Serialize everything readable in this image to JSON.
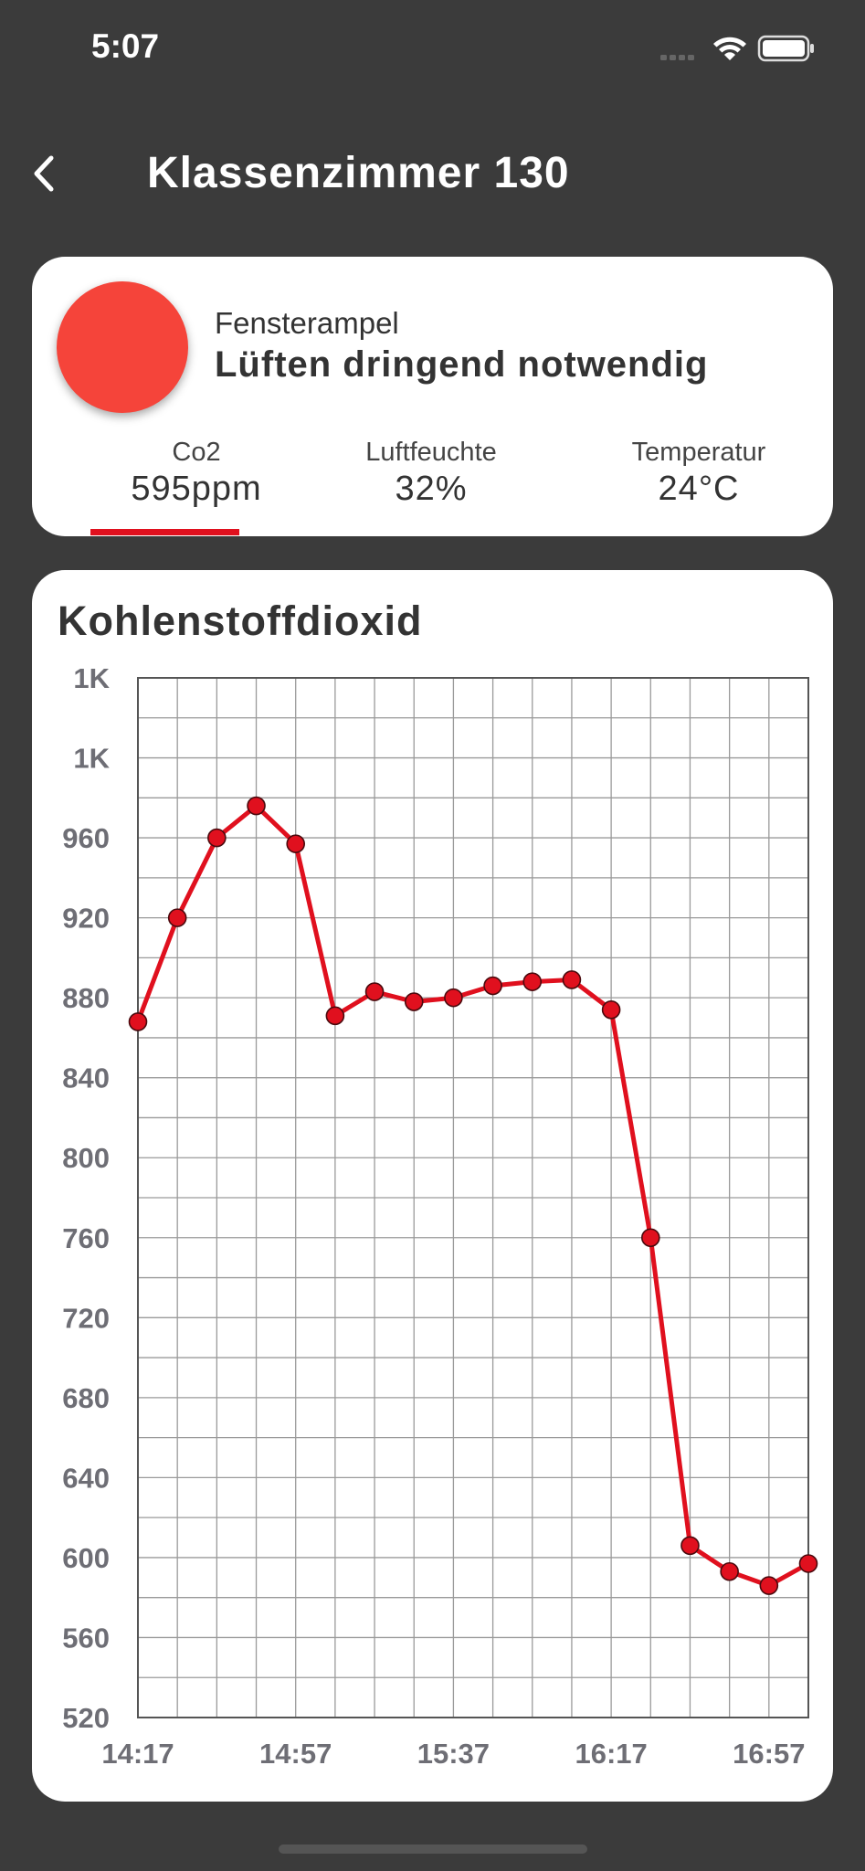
{
  "status_bar": {
    "time": "5:07"
  },
  "nav": {
    "title": "Klassenzimmer 130"
  },
  "status_card": {
    "label": "Fensterampel",
    "status": "Lüften dringend notwendig",
    "light_color": "#f5443a",
    "metrics": [
      {
        "label": "Co2",
        "value": "595ppm"
      },
      {
        "label": "Luftfeuchte",
        "value": "32%"
      },
      {
        "label": "Temperatur",
        "value": "24°C"
      }
    ],
    "selected_metric": "Co2"
  },
  "chart": {
    "title": "Kohlenstoffdioxid",
    "y_tick_labels": [
      "1K",
      "1K",
      "960",
      "920",
      "880",
      "840",
      "800",
      "760",
      "720",
      "680",
      "640",
      "600",
      "560",
      "520"
    ],
    "x_tick_labels": [
      "14:17",
      "14:57",
      "15:37",
      "16:17",
      "16:57"
    ]
  },
  "chart_data": {
    "type": "line",
    "title": "Kohlenstoffdioxid",
    "xlabel": "",
    "ylabel": "",
    "ylim": [
      520,
      1040
    ],
    "grid": true,
    "x": [
      "14:17",
      "14:27",
      "14:37",
      "14:47",
      "14:57",
      "15:07",
      "15:17",
      "15:27",
      "15:37",
      "15:47",
      "15:57",
      "16:07",
      "16:17",
      "16:27",
      "16:37",
      "16:47",
      "16:57",
      "17:07"
    ],
    "series": [
      {
        "color": "#e0101e",
        "values": [
          868,
          920,
          960,
          976,
          957,
          871,
          883,
          878,
          880,
          886,
          888,
          889,
          874,
          760,
          606,
          593,
          586,
          597
        ]
      }
    ]
  }
}
